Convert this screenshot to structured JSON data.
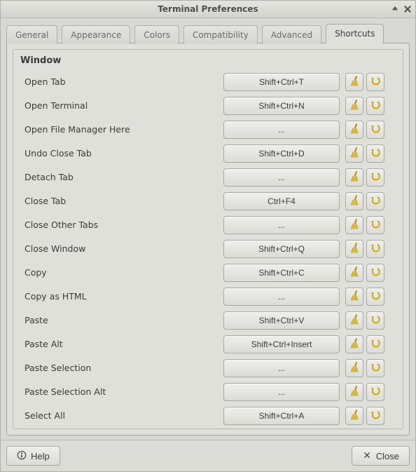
{
  "window": {
    "title": "Terminal Preferences"
  },
  "tabs": [
    {
      "label": "General",
      "active": false
    },
    {
      "label": "Appearance",
      "active": false
    },
    {
      "label": "Colors",
      "active": false
    },
    {
      "label": "Compatibility",
      "active": false
    },
    {
      "label": "Advanced",
      "active": false
    },
    {
      "label": "Shortcuts",
      "active": true
    }
  ],
  "group": {
    "title": "Window",
    "rows": [
      {
        "label": "Open Tab",
        "shortcut": "Shift+Ctrl+T"
      },
      {
        "label": "Open Terminal",
        "shortcut": "Shift+Ctrl+N"
      },
      {
        "label": "Open File Manager Here",
        "shortcut": "..."
      },
      {
        "label": "Undo Close Tab",
        "shortcut": "Shift+Ctrl+D"
      },
      {
        "label": "Detach Tab",
        "shortcut": "..."
      },
      {
        "label": "Close Tab",
        "shortcut": "Ctrl+F4"
      },
      {
        "label": "Close Other Tabs",
        "shortcut": "..."
      },
      {
        "label": "Close Window",
        "shortcut": "Shift+Ctrl+Q"
      },
      {
        "label": "Copy",
        "shortcut": "Shift+Ctrl+C"
      },
      {
        "label": "Copy as HTML",
        "shortcut": "..."
      },
      {
        "label": "Paste",
        "shortcut": "Shift+Ctrl+V"
      },
      {
        "label": "Paste Alt",
        "shortcut": "Shift+Ctrl+Insert"
      },
      {
        "label": "Paste Selection",
        "shortcut": "..."
      },
      {
        "label": "Paste Selection Alt",
        "shortcut": "..."
      },
      {
        "label": "Select All",
        "shortcut": "Shift+Ctrl+A"
      }
    ]
  },
  "footer": {
    "help_label": "Help",
    "close_label": "Close"
  }
}
